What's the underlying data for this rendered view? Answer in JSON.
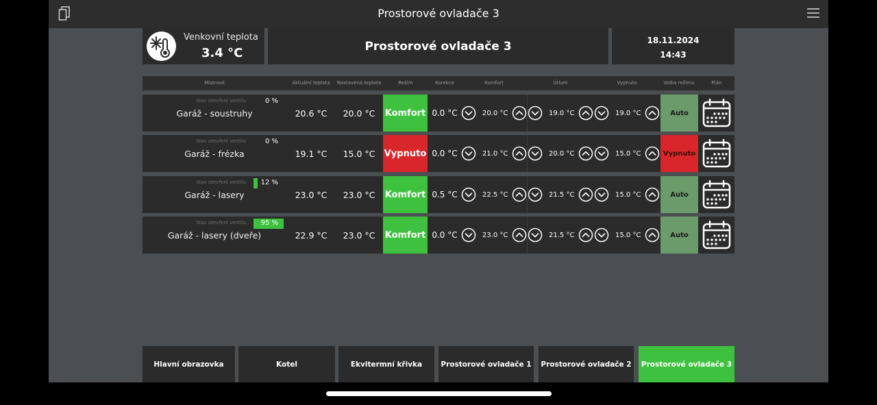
{
  "window": {
    "title": "Prostorové ovladače 3"
  },
  "outdoor": {
    "label": "Venkovní teplota",
    "value": "3.4 °C"
  },
  "header": {
    "title": "Prostorové ovladače 3",
    "date": "18.11.2024",
    "time": "14:43"
  },
  "columns": [
    "Místnost",
    "Aktuální teplota",
    "Nastavená teplota",
    "Režim",
    "Korekce",
    "Komfort",
    "Útlum",
    "Vypnuto",
    "Volba režimu",
    "Plán"
  ],
  "rooms": [
    {
      "name": "Garáž - soustruhy",
      "valve_label": "Stav otevření ventilu",
      "valve_pct": "0 %",
      "valve_level": 0,
      "actual": "20.6 °C",
      "setpoint": "20.0 °C",
      "mode": "Komfort",
      "mode_color": "#3ec13e",
      "correction": "0.0 °C",
      "comfort": "20.0 °C",
      "setback": "19.0 °C",
      "off": "19.0 °C",
      "selection": "Auto",
      "selection_color": "#6b9a6b",
      "selection_text_color": "#1a1a1a"
    },
    {
      "name": "Garáž - frézka",
      "valve_label": "Stav otevření ventilu",
      "valve_pct": "0 %",
      "valve_level": 0,
      "actual": "19.1 °C",
      "setpoint": "15.0 °C",
      "mode": "Vypnuto",
      "mode_color": "#d9262b",
      "correction": "0.0 °C",
      "comfort": "21.0 °C",
      "setback": "20.0 °C",
      "off": "15.0 °C",
      "selection": "Vypnuto",
      "selection_color": "#d9262b",
      "selection_text_color": "#3a0a0a"
    },
    {
      "name": "Garáž - lasery",
      "valve_label": "Stav otevření ventilu",
      "valve_pct": "12 %",
      "valve_level": 12,
      "actual": "23.0 °C",
      "setpoint": "23.0 °C",
      "mode": "Komfort",
      "mode_color": "#3ec13e",
      "correction": "0.5 °C",
      "comfort": "22.5 °C",
      "setback": "21.5 °C",
      "off": "15.0 °C",
      "selection": "Auto",
      "selection_color": "#6b9a6b",
      "selection_text_color": "#1a1a1a"
    },
    {
      "name": "Garáž - lasery (dveře)",
      "valve_label": "Stav otevření ventilu",
      "valve_pct": "95 %",
      "valve_level": 95,
      "actual": "22.9 °C",
      "setpoint": "23.0 °C",
      "mode": "Komfort",
      "mode_color": "#3ec13e",
      "correction": "0.0 °C",
      "comfort": "23.0 °C",
      "setback": "21.5 °C",
      "off": "15.0 °C",
      "selection": "Auto",
      "selection_color": "#6b9a6b",
      "selection_text_color": "#1a1a1a"
    }
  ],
  "footer_tabs": [
    {
      "label": "Hlavní obrazovka",
      "active": false
    },
    {
      "label": "Kotel",
      "active": false
    },
    {
      "label": "Ekvitermní křivka",
      "active": false
    },
    {
      "label": "Prostorové ovladače 1",
      "active": false
    },
    {
      "label": "Prostorové ovladače 2",
      "active": false
    },
    {
      "label": "Prostorové ovladače 3",
      "active": true
    }
  ],
  "colors": {
    "accent_green": "#3ec13e",
    "alert_red": "#d9262b",
    "panel": "#2b2b2b",
    "background": "#4b4f52"
  }
}
